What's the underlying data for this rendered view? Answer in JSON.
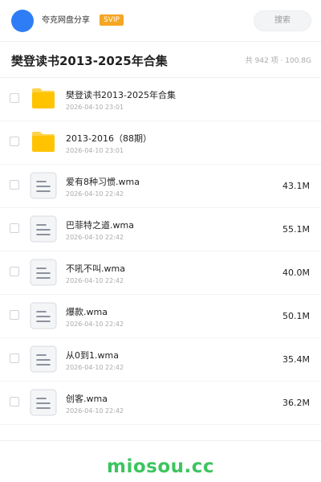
{
  "header": {
    "user_name": "夸克网盘分享",
    "vip_badge": "SVIP",
    "search_placeholder": "搜索"
  },
  "folder": {
    "title": "樊登读书2013-2025年合集",
    "meta": "共 942 项 · 100.8G"
  },
  "files": [
    {
      "name": "樊登读书2013-2025年合集",
      "date": "2026-04-10 23:01",
      "size": "",
      "type": "folder"
    },
    {
      "name": "2013-2016（88期）",
      "date": "2026-04-10 23:01",
      "size": "",
      "type": "folder"
    },
    {
      "name": "爱有8种习惯.wma",
      "date": "2026-04-10 22:42",
      "size": "43.1M",
      "type": "audio"
    },
    {
      "name": "巴菲特之道.wma",
      "date": "2026-04-10 22:42",
      "size": "55.1M",
      "type": "audio"
    },
    {
      "name": "不吼不叫.wma",
      "date": "2026-04-10 22:42",
      "size": "40.0M",
      "type": "audio"
    },
    {
      "name": "爆款.wma",
      "date": "2026-04-10 22:42",
      "size": "50.1M",
      "type": "audio"
    },
    {
      "name": "从0到1.wma",
      "date": "2026-04-10 22:42",
      "size": "35.4M",
      "type": "audio"
    },
    {
      "name": "创客.wma",
      "date": "2026-04-10 22:42",
      "size": "36.2M",
      "type": "audio"
    }
  ],
  "footer": {
    "brand": "miosou.cc"
  },
  "colors": {
    "avatar": "#2f7df6",
    "vip": "#f5a623",
    "folder": "#ffc300",
    "brand": "#3cc55f"
  },
  "icons": {
    "folder": "folder-icon",
    "audio": "file-doc-icon"
  }
}
